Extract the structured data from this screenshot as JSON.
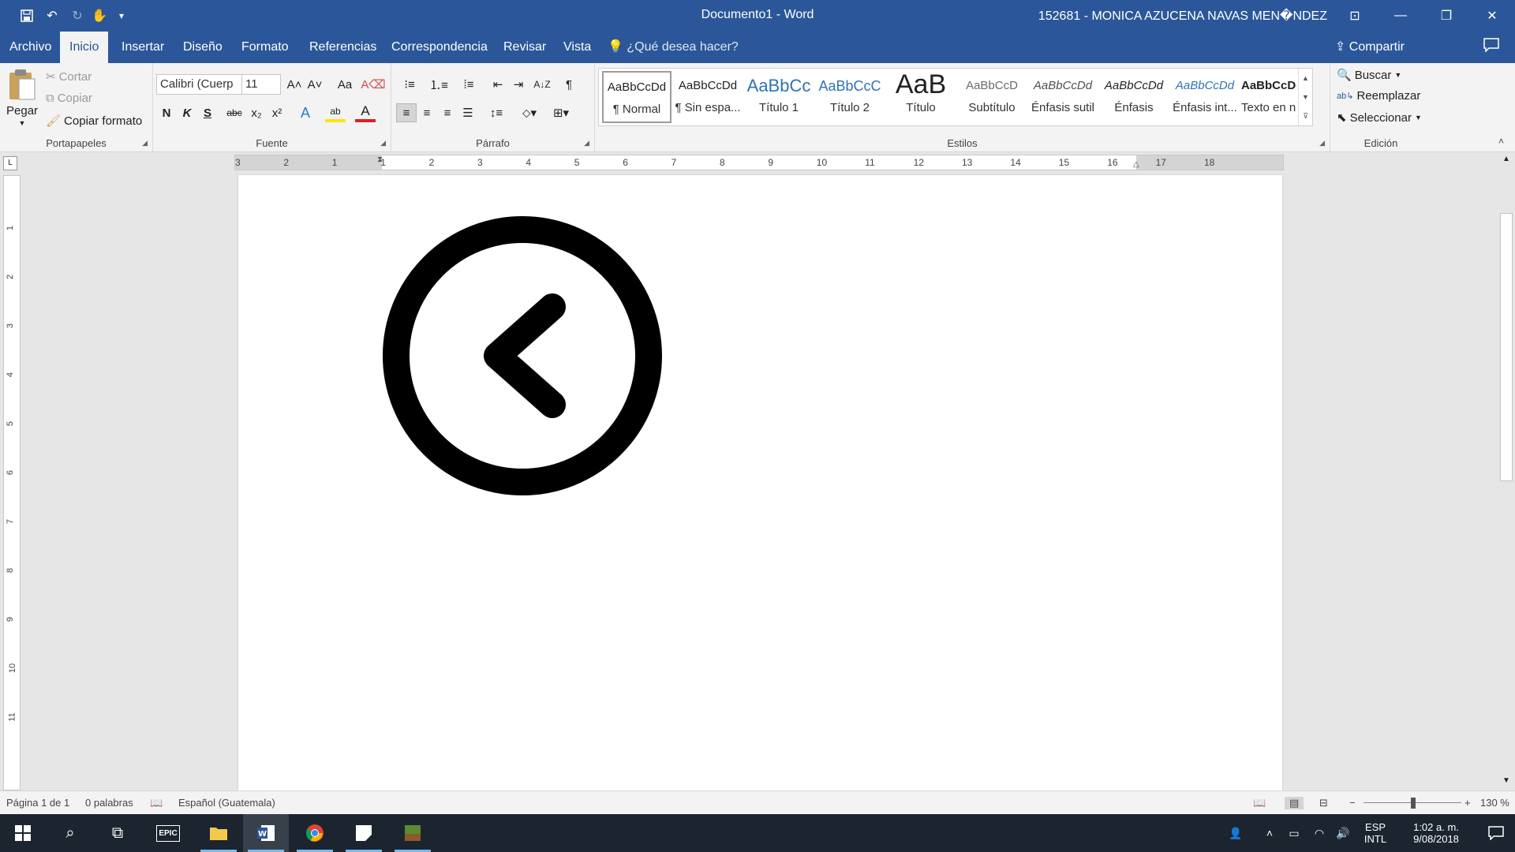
{
  "window": {
    "title": "Documento1 - Word",
    "user": "152681 - MONICA AZUCENA NAVAS MEN�NDEZ",
    "accent": "#2b579a"
  },
  "qat": {
    "save_icon": "💾",
    "undo_icon": "↶",
    "redo_icon": "↻",
    "touch_icon": "✋",
    "customize_icon": "▾"
  },
  "window_controls": {
    "ribbon_display": "⊡",
    "minimize": "—",
    "restore": "❐",
    "close": "✕"
  },
  "tabs": [
    "Archivo",
    "Inicio",
    "Insertar",
    "Diseño",
    "Formato",
    "Referencias",
    "Correspondencia",
    "Revisar",
    "Vista"
  ],
  "tell_me": "¿Qué desea hacer?",
  "share_label": "Compartir",
  "clipboard": {
    "label": "Portapapeles",
    "paste": "Pegar",
    "cut": "Cortar",
    "copy": "Copiar",
    "format_painter": "Copiar formato"
  },
  "font": {
    "label": "Fuente",
    "family": "Calibri (Cuerp",
    "size": "11",
    "grow": "A˄",
    "shrink": "A˅",
    "case": "Aa",
    "clear": "A⌫",
    "bold": "N",
    "italic": "K",
    "underline": "S",
    "strike": "abc",
    "subscript": "x₂",
    "superscript": "x²",
    "effects": "A",
    "highlight": "ab",
    "color": "A"
  },
  "paragraph": {
    "label": "Párrafo",
    "pilcrow": "¶",
    "sort": "A↓Z"
  },
  "styles": {
    "label": "Estilos",
    "items": [
      {
        "sample": "AaBbCcDd",
        "name": "¶ Normal"
      },
      {
        "sample": "AaBbCcDd",
        "name": "¶ Sin espa..."
      },
      {
        "sample": "AaBbCc",
        "name": "Título 1"
      },
      {
        "sample": "AaBbCcC",
        "name": "Título 2"
      },
      {
        "sample": "AaB",
        "name": "Título"
      },
      {
        "sample": "AaBbCcD",
        "name": "Subtítulo"
      },
      {
        "sample": "AaBbCcDd",
        "name": "Énfasis sutil"
      },
      {
        "sample": "AaBbCcDd",
        "name": "Énfasis"
      },
      {
        "sample": "AaBbCcDd",
        "name": "Énfasis int..."
      },
      {
        "sample": "AaBbCcDc",
        "name": "Texto en n..."
      }
    ]
  },
  "editing": {
    "label": "Edición",
    "find": "Buscar",
    "replace": "Reemplazar",
    "select": "Seleccionar"
  },
  "ruler": {
    "h_ticks": [
      "3",
      "2",
      "1",
      "1",
      "2",
      "3",
      "4",
      "5",
      "6",
      "7",
      "8",
      "9",
      "10",
      "11",
      "12",
      "13",
      "14",
      "15",
      "16",
      "17",
      "18"
    ],
    "v_ticks": [
      "1",
      "2",
      "3",
      "4",
      "5",
      "6",
      "7",
      "8",
      "9",
      "10",
      "11"
    ],
    "corner": "L"
  },
  "document": {
    "shape_icon": "chevron-left-circle"
  },
  "status": {
    "page": "Página 1 de 1",
    "words": "0 palabras",
    "language": "Español (Guatemala)",
    "zoom": "130 %",
    "zoom_minus": "−",
    "zoom_plus": "+"
  },
  "taskbar": {
    "epic_label": "EPIC",
    "lang_top": "ESP",
    "lang_bottom": "INTL",
    "time": "1:02 a. m.",
    "date": "9/08/2018"
  }
}
